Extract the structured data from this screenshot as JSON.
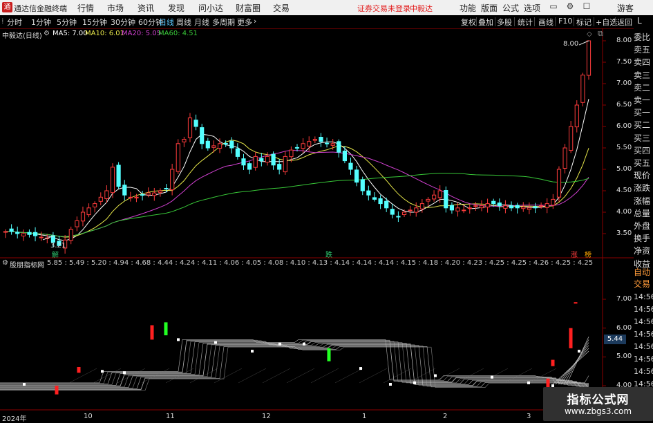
{
  "window": {
    "title": "通达信金融终端",
    "app_icon": "TDX"
  },
  "menu": [
    "行情",
    "市场",
    "资讯",
    "发现",
    "问小达",
    "财富圈",
    "交易"
  ],
  "warning": {
    "text": "证券交易未登录",
    "stock": "中毅达"
  },
  "right_menu": [
    "功能",
    "版面",
    "公式",
    "选项"
  ],
  "user": "游客",
  "period_tabs": [
    "分时",
    "1分钟",
    "5分钟",
    "15分钟",
    "30分钟",
    "60分钟",
    "日线",
    "周线",
    "月线",
    "多周期",
    "更多"
  ],
  "active_tab": "日线",
  "right_tools": [
    "复权",
    "叠加",
    "多股",
    "统计",
    "画线",
    "F10",
    "标记",
    "+自选",
    "返回"
  ],
  "corner_label": "L",
  "main": {
    "stock_title": "中毅达(日线)",
    "ma": [
      {
        "label": "MA5: 7.00",
        "color": "#ffffff"
      },
      {
        "label": "MA10: 6.01",
        "color": "#e8e84a"
      },
      {
        "label": "MA20: 5.05",
        "color": "#d040d0"
      },
      {
        "label": "MA60: 4.51",
        "color": "#38c838"
      }
    ],
    "yaxis": [
      "8.00",
      "7.50",
      "7.00",
      "6.50",
      "6.00",
      "5.50",
      "5.00",
      "4.50",
      "4.00",
      "3.50"
    ],
    "high_label": "8.00",
    "low_label": "3.21",
    "tags": {
      "jie": "解",
      "die": "跌",
      "zhang": "涨",
      "bang": "榜"
    }
  },
  "side_labels": [
    "委比",
    "卖五",
    "卖四",
    "卖三",
    "卖二",
    "卖一",
    "买一",
    "买二",
    "买三",
    "买四",
    "买五",
    "现价",
    "涨跌",
    "涨幅",
    "总量",
    "外盘",
    "换手",
    "净资",
    "收益"
  ],
  "side_labels2": [
    "自动",
    "交易"
  ],
  "sub": {
    "title": "股朋指标网",
    "values": "5.85 : 5.49 : 5.20 : 4.94 : 4.68 : 4.44 : 4.24 : 4.11 : 4.06 : 4.05 : 4.08 : 4.10 : 4.13 : 4.14 : 4.14 : 4.14 : 4.15 : 4.18 : 4.20 : 4.23 : 4.25 : 4.25 : 4.26 : 4.25 : 4.25",
    "yaxis": [
      "7.00",
      "6.00",
      "5.00",
      "4.00"
    ],
    "current": "5.44",
    "times": [
      "14:56",
      "14:56",
      "14:56",
      "14:56",
      "14:56",
      "14:56",
      "14:56",
      "14:56",
      "14:56"
    ]
  },
  "xaxis": [
    "2024年",
    "10",
    "11",
    "12",
    "1",
    "2",
    "3"
  ],
  "watermark": {
    "title": "指标公式网",
    "url": "www.zbgs3.com"
  },
  "chart_data": {
    "type": "candlestick",
    "title": "中毅达(日线)",
    "y_range": [
      3.21,
      8.0
    ],
    "series": [
      {
        "name": "MA5",
        "last": 7.0
      },
      {
        "name": "MA10",
        "last": 6.01
      },
      {
        "name": "MA20",
        "last": 5.05
      },
      {
        "name": "MA60",
        "last": 4.51
      }
    ],
    "approx_close": [
      3.55,
      3.55,
      3.5,
      3.5,
      3.48,
      3.45,
      3.42,
      3.4,
      3.3,
      3.22,
      3.35,
      3.6,
      3.8,
      4.0,
      4.1,
      4.2,
      4.35,
      4.5,
      5.05,
      4.6,
      4.4,
      4.35,
      4.35,
      4.4,
      4.45,
      4.45,
      4.5,
      4.55,
      5.0,
      5.6,
      5.7,
      6.2,
      6.0,
      5.6,
      5.5,
      5.55,
      5.6,
      5.6,
      5.5,
      5.3,
      5.1,
      5.0,
      5.3,
      5.2,
      5.3,
      5.1,
      5.0,
      5.3,
      5.45,
      5.5,
      5.6,
      5.65,
      5.7,
      5.65,
      5.6,
      5.6,
      5.4,
      5.2,
      5.0,
      4.7,
      4.5,
      4.4,
      4.3,
      4.2,
      4.1,
      3.95,
      3.9,
      4.0,
      4.05,
      4.1,
      4.2,
      4.3,
      4.4,
      4.5,
      4.1,
      4.05,
      4.1,
      4.05,
      4.1,
      4.15,
      4.15,
      4.2,
      4.2,
      4.15,
      4.15,
      4.1,
      4.1,
      4.12,
      4.1,
      4.1,
      4.15,
      4.2,
      4.3,
      5.0,
      5.5,
      6.0,
      6.5,
      7.2,
      8.0
    ]
  }
}
